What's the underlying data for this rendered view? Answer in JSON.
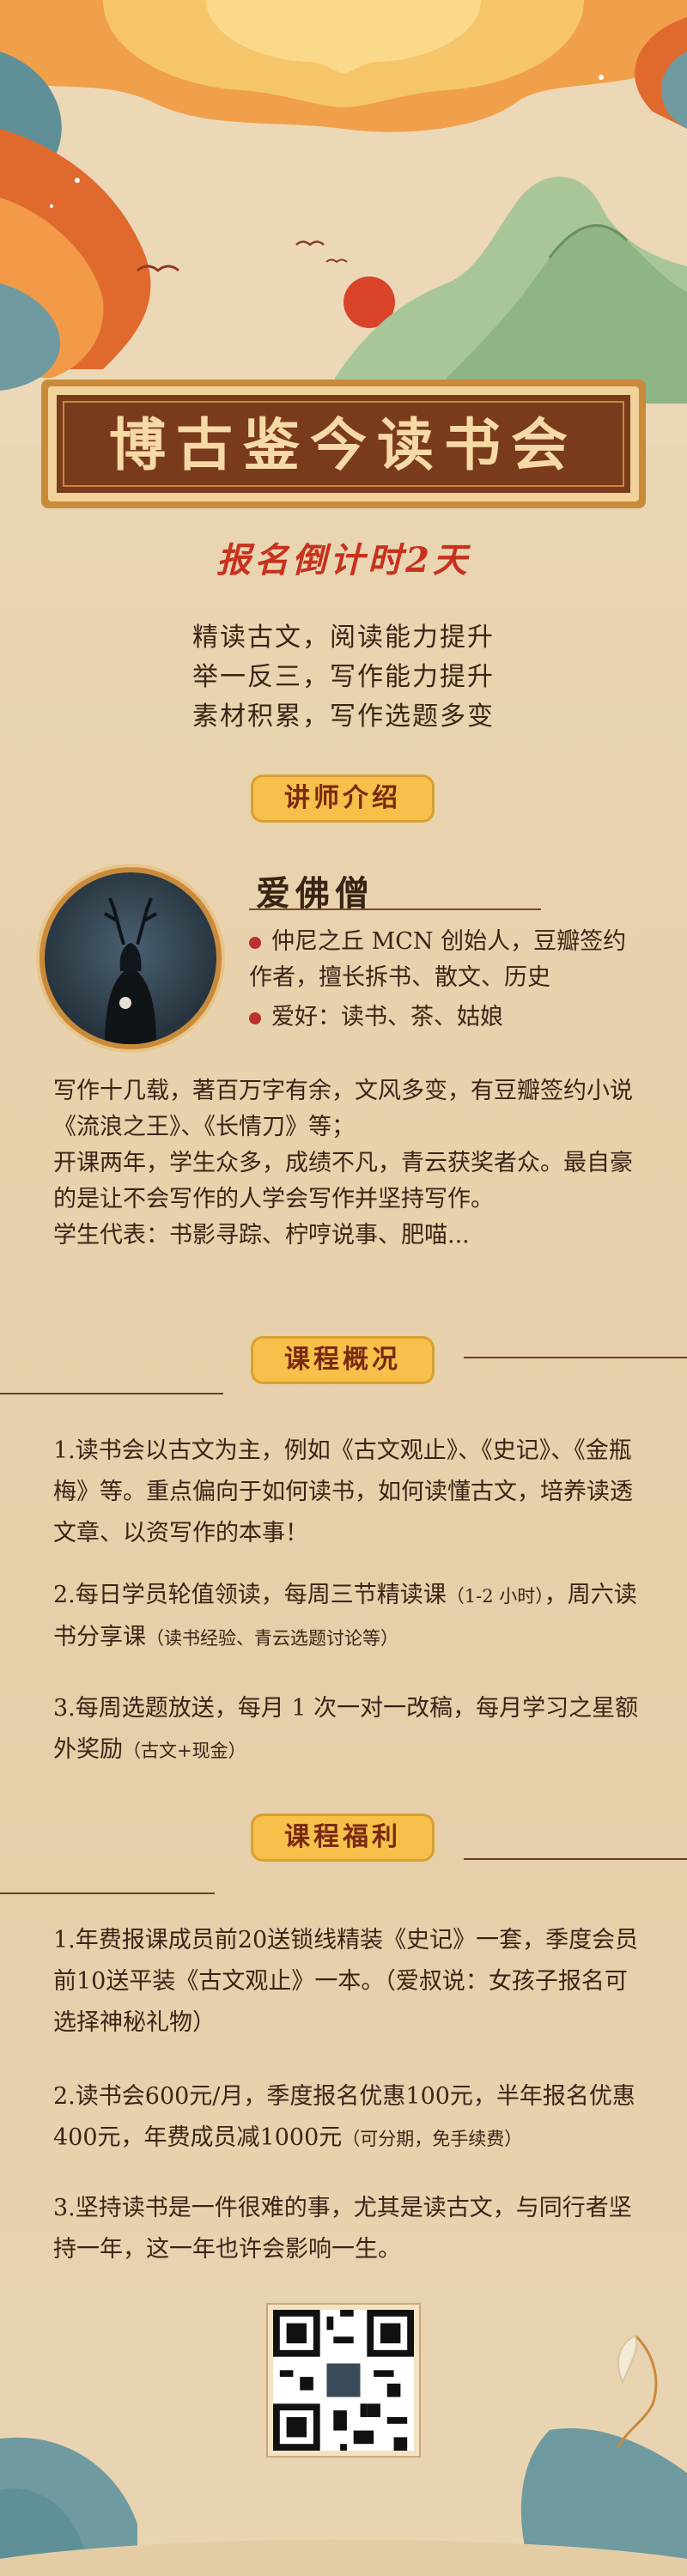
{
  "title": "博古鉴今读书会",
  "countdown": "报名倒计时2天",
  "slogans": [
    "精读古文，阅读能力提升",
    "举一反三，写作能力提升",
    "素材积累，写作选题多变"
  ],
  "sections": {
    "teacher": "讲师介绍",
    "overview": "课程概况",
    "benefits": "课程福利"
  },
  "teacher": {
    "name": "爱佛僧",
    "bullet1": "仲尼之丘 MCN 创始人，豆瓣签约作者，擅长拆书、散文、历史",
    "bullet2": "爱好：读书、茶、姑娘",
    "bio_lines": [
      "写作十几载，著百万字有余，文风多变，有豆瓣签约小说《流浪之王》、《长情刀》等；",
      "开课两年，学生众多，成绩不凡，青云获奖者众。最自豪的是让不会写作的人学会写作并坚持写作。",
      "学生代表：书影寻踪、柠哼说事、肥喵..."
    ]
  },
  "overview": {
    "p1": "1.读书会以古文为主，例如《古文观止》、《史记》、《金瓶梅》等。重点偏向于如何读书，如何读懂古文，培养读透文章、以资写作的本事！",
    "p2": "2.每日学员轮值领读，每周三节精读课",
    "p2_small1": "（1-2 小时）",
    "p2_mid": "，周六读书分享课",
    "p2_small2": "（读书经验、青云选题讨论等）",
    "p3": "3.每周选题放送，每月 1 次一对一改稿，每月学习之星额外奖励",
    "p3_small": "（古文+现金）"
  },
  "benefits": {
    "p1": "1.年费报课成员前20送锁线精装《史记》一套，季度会员前10送平装《古文观止》一本。（爱叔说：女孩子报名可选择神秘礼物）",
    "p2": "2.读书会600元/月，季度报名优惠100元，半年报名优惠400元，年费成员减1000元",
    "p2_small": "（可分期，免手续费）",
    "p3": "3.坚持读书是一件很难的事，尤其是读古文，与同行者坚持一年，这一年也许会影响一生。"
  },
  "colors": {
    "accent": "#f6c04a",
    "title_red": "#c6321e",
    "banner": "#7a3a1c"
  }
}
